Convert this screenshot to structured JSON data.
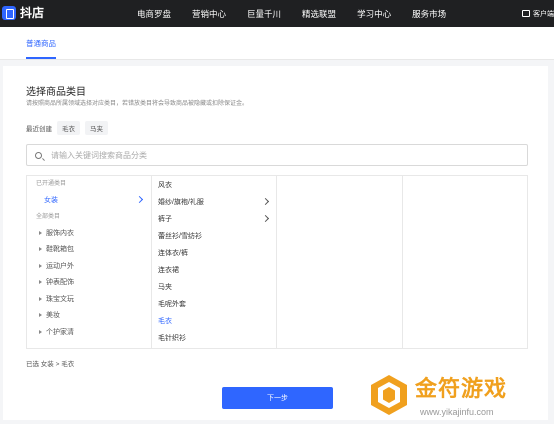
{
  "header": {
    "logo_text": "抖店",
    "nav": [
      "电商罗盘",
      "营销中心",
      "巨量千川",
      "精选联盟",
      "学习中心",
      "服务市场"
    ],
    "user_text": "客户端"
  },
  "tabs": {
    "active_label": "普通商品"
  },
  "main": {
    "title": "选择商品类目",
    "description": "请按照商品所属领域选择对应类目，若错放类目将会导致商品被隐藏或扣除保证金。",
    "recent_label": "最近创建",
    "recent_tags": [
      "毛衣",
      "马夹"
    ],
    "search_placeholder": "请输入关键词搜索商品分类",
    "col1": {
      "opened_label": "已开通类目",
      "opened_items": [
        "女装"
      ],
      "all_label": "全部类目",
      "all_items": [
        "服饰内衣",
        "鞋靴箱包",
        "运动户外",
        "钟表配饰",
        "珠宝文玩",
        "美妆",
        "个护家清"
      ]
    },
    "col2": {
      "items": [
        "风衣",
        "婚纱/旗袍/礼服",
        "裤子",
        "蕾丝衫/雪纺衫",
        "连体衣/裤",
        "连衣裙",
        "马夹",
        "毛呢外套",
        "毛衣",
        "毛针织衫"
      ],
      "selected": "毛衣"
    },
    "selected_path": "已选  女装 > 毛衣",
    "next_button": "下一步"
  },
  "watermark": {
    "title": "金符游戏",
    "url": "www.yikajinfu.com"
  },
  "colors": {
    "accent": "#2f66ff",
    "topbar": "#1f2022",
    "watermark": "#f0a01e"
  }
}
